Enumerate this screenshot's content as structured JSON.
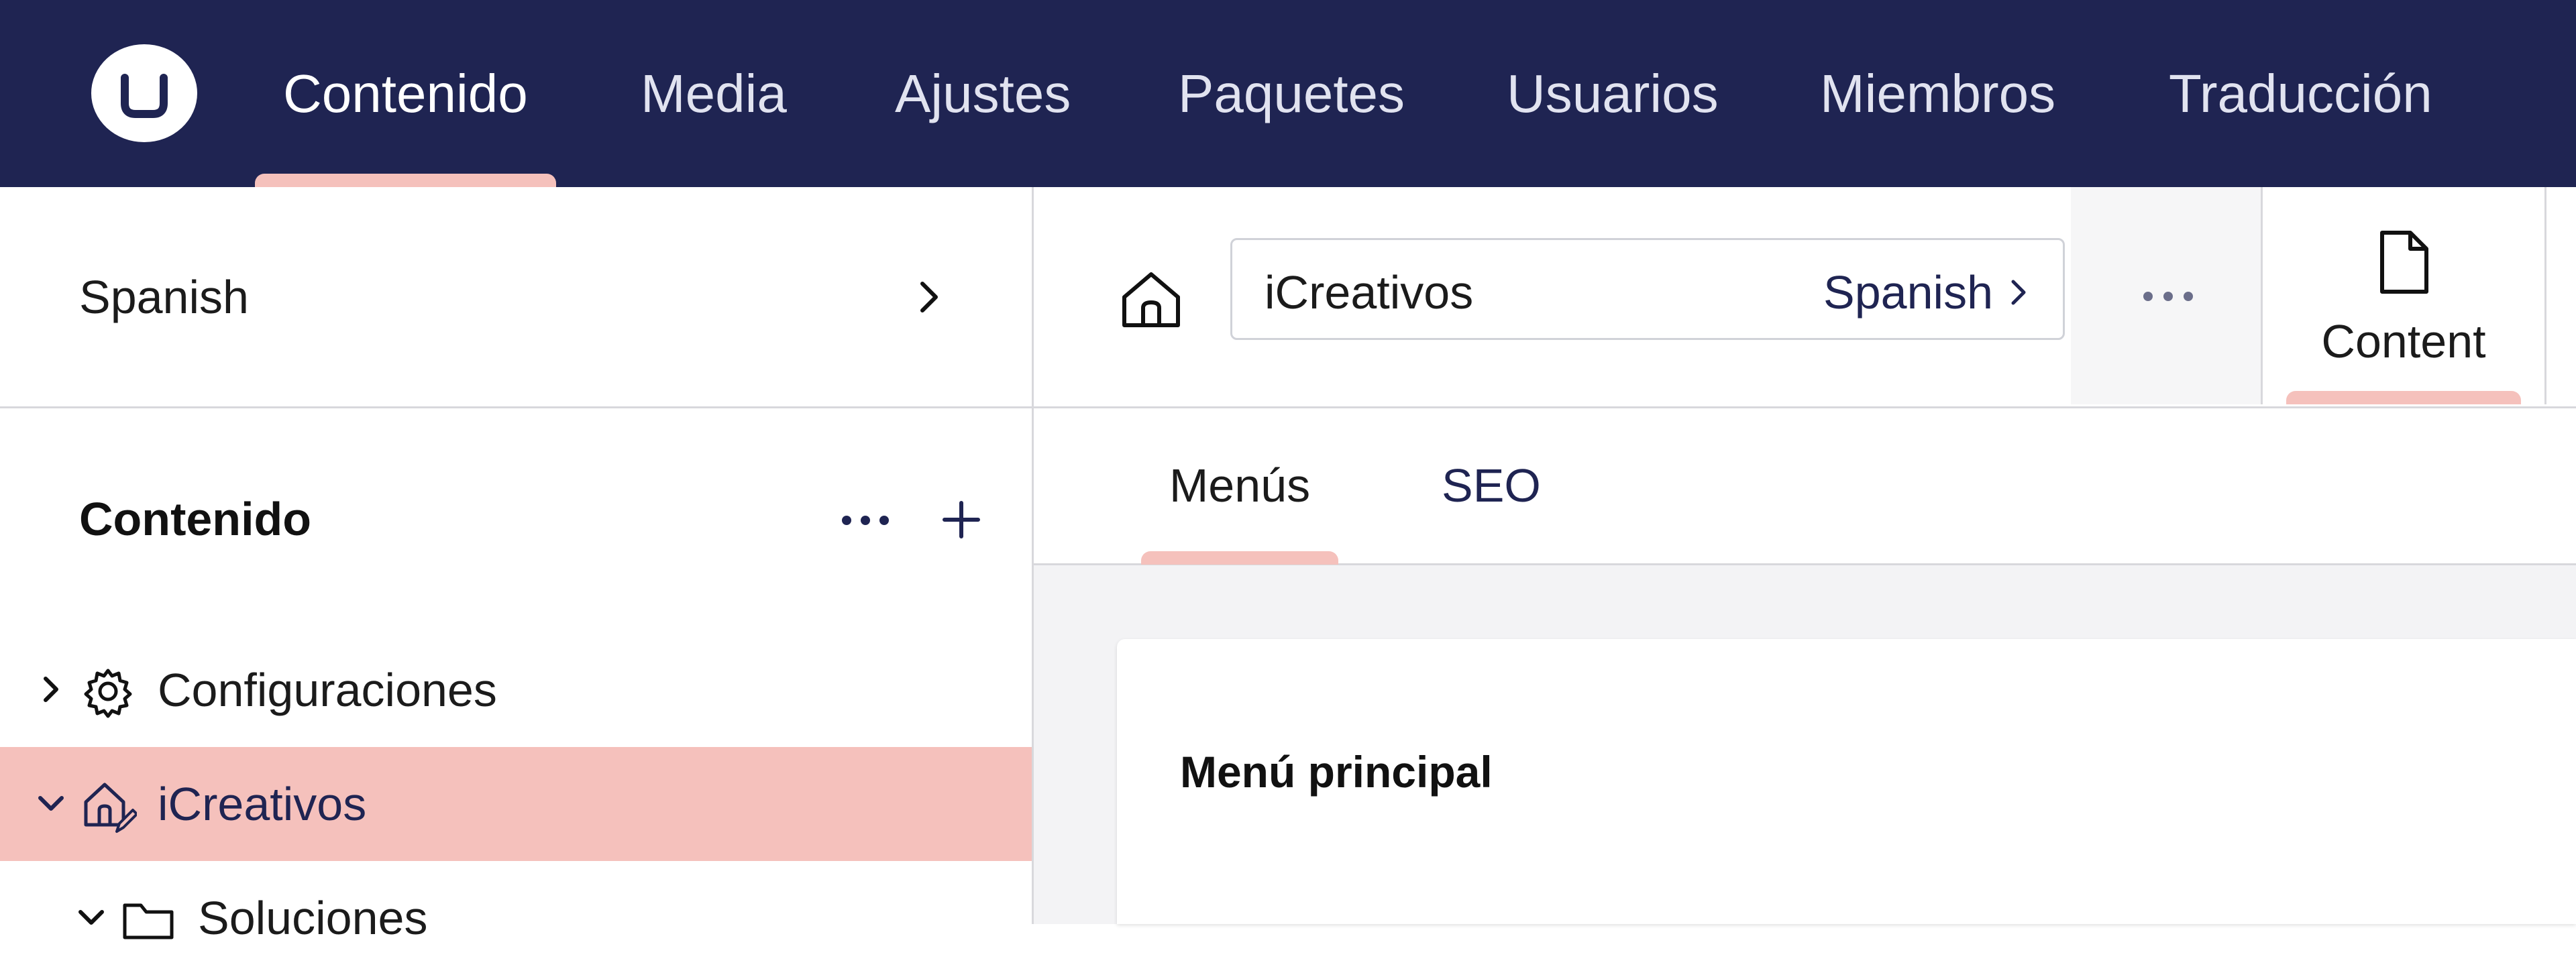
{
  "header": {
    "nav": [
      {
        "label": "Contenido",
        "active": true
      },
      {
        "label": "Media"
      },
      {
        "label": "Ajustes"
      },
      {
        "label": "Paquetes"
      },
      {
        "label": "Usuarios"
      },
      {
        "label": "Miembros"
      },
      {
        "label": "Traducción"
      }
    ]
  },
  "sidebar": {
    "culture": "Spanish",
    "tree_title": "Contenido",
    "items": [
      {
        "label": "Configuraciones",
        "icon": "gear-icon",
        "expanded": false
      },
      {
        "label": "iCreativos",
        "icon": "home-edit-icon",
        "expanded": true,
        "active": true
      },
      {
        "label": "Soluciones",
        "icon": "folder-icon",
        "expanded": true
      }
    ]
  },
  "workspace": {
    "name": "iCreativos",
    "variant": "Spanish",
    "view_tab": "Content",
    "tabs": [
      {
        "label": "Menús",
        "active": true
      },
      {
        "label": "SEO"
      }
    ],
    "card_title": "Menú principal"
  },
  "colors": {
    "nav_bg": "#1f2452",
    "accent": "#f5c1bc",
    "content_bg": "#f3f3f5"
  }
}
